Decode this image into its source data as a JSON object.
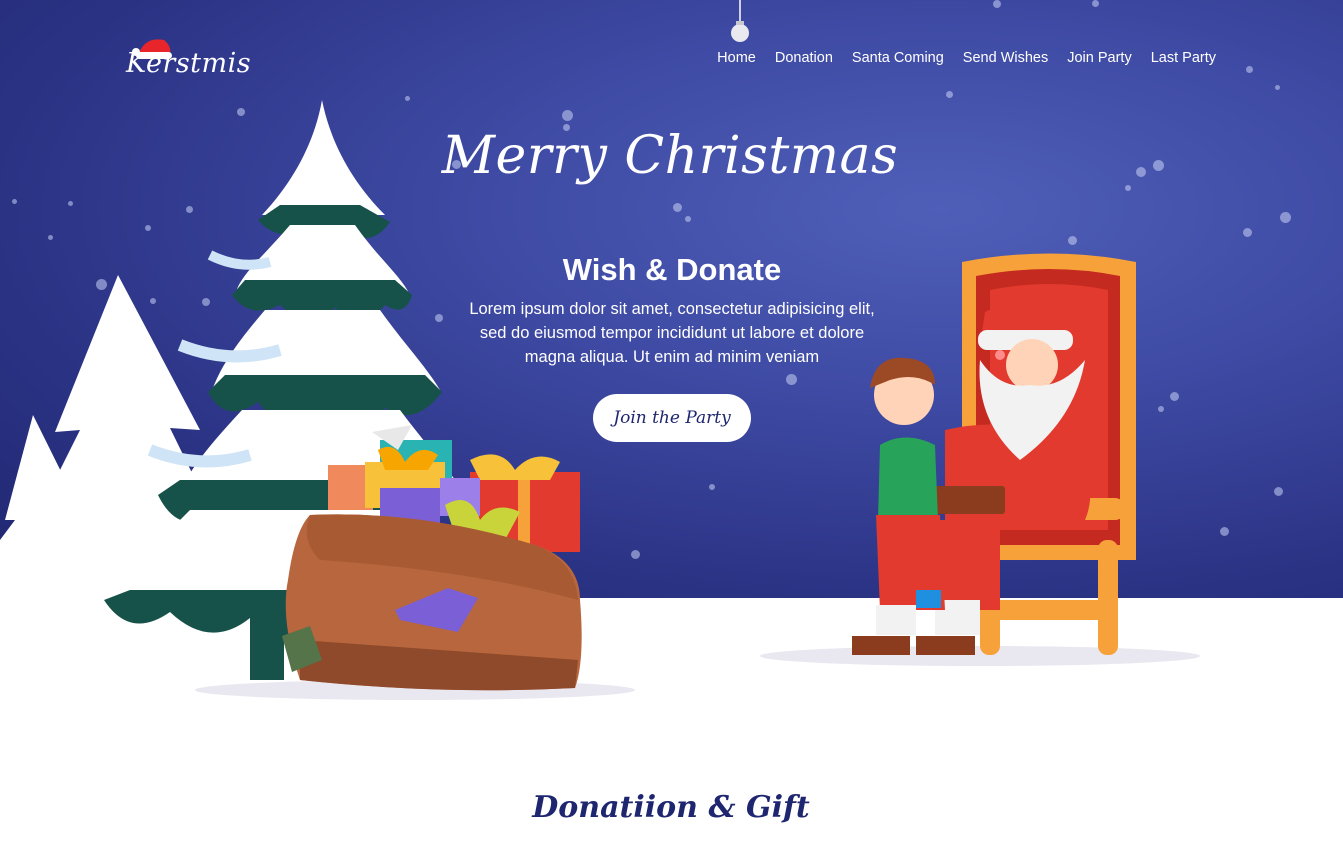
{
  "brand": {
    "name": "Kerstmis",
    "hat_color": "#e8252b"
  },
  "nav": {
    "items": [
      "Home",
      "Donation",
      "Santa Coming",
      "Send Wishes",
      "Join Party",
      "Last Party"
    ]
  },
  "hero": {
    "script_title": "Merry Christmas",
    "headline": "Wish & Donate",
    "body_lines": [
      "Lorem ipsum dolor sit amet, consectetur adipisicing elit,",
      "sed do eiusmod tempor incididunt ut labore et dolore",
      "magna aliqua. Ut enim ad minim veniam"
    ],
    "cta_label": "Join the Party"
  },
  "section": {
    "title": "Donatiion & Gift"
  },
  "colors": {
    "sky_dark": "#1f2670",
    "sky_light": "#4f5fb8",
    "snow": "#ffffff",
    "tree_green": "#17524a",
    "sack_brown": "#b8663d",
    "santa_red": "#e23a2e",
    "chair_orange": "#f7a13b"
  },
  "icons": {
    "logo_hat": "santa-hat-icon",
    "ornament": "bauble-icon"
  }
}
